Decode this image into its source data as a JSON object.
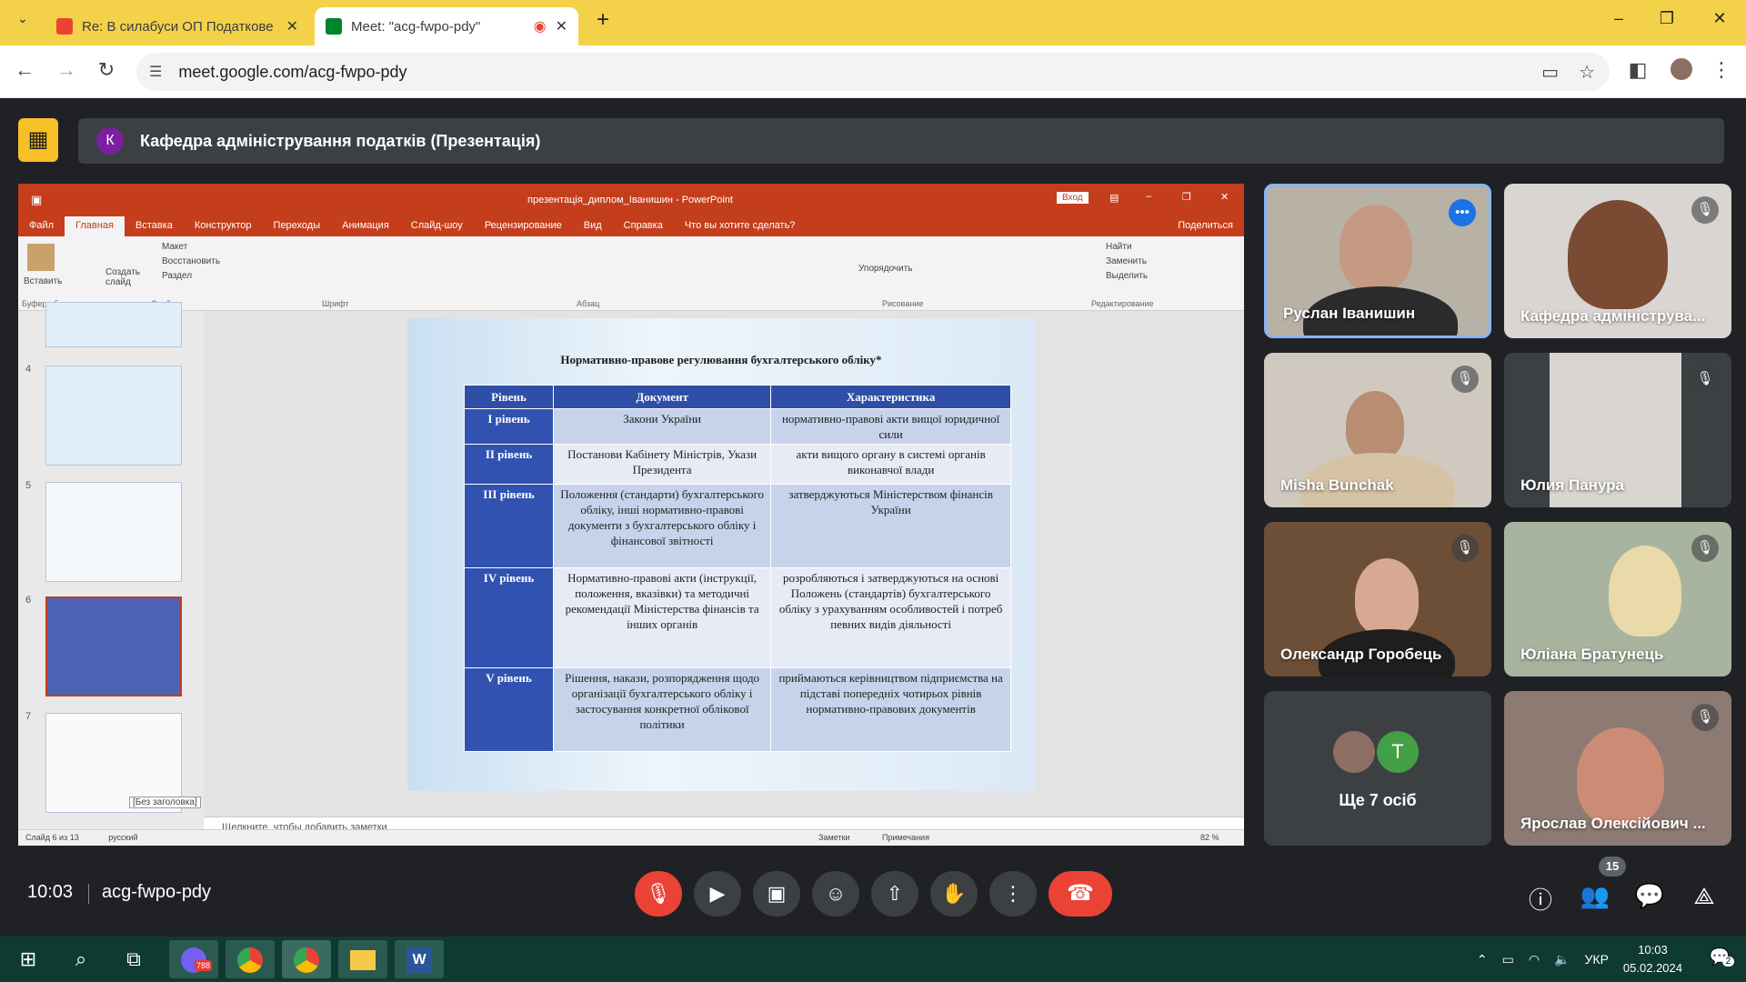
{
  "browser": {
    "tabs": [
      {
        "title": "Re: В силабуси ОП Податкове",
        "favicon_color": "#ea4335"
      },
      {
        "title": "Meet: \"acg-fwpo-pdy\"",
        "favicon_color": "#00832d"
      }
    ],
    "url": "meet.google.com/acg-fwpo-pdy"
  },
  "meet": {
    "presenter_initial": "К",
    "presentation_title": "Кафедра адміністрування податків (Презентація)",
    "time": "10:03",
    "meeting_code": "acg-fwpo-pdy",
    "participant_count": "15",
    "more_people": "Ще 7 осіб",
    "more_initial": "T"
  },
  "participants": [
    {
      "name": "Руслан Іванишин",
      "speaking": true
    },
    {
      "name": "Кафедра адмініструва...",
      "muted": true
    },
    {
      "name": "Misha Bunchak",
      "muted": true
    },
    {
      "name": "Юлия Панура",
      "muted": true
    },
    {
      "name": "Олександр Горобець",
      "muted": true
    },
    {
      "name": "Юліана Братунець",
      "muted": true
    },
    {
      "name": "Ярослав Олексійович ...",
      "muted": true
    }
  ],
  "powerpoint": {
    "window_title": "презентація_диплом_Іванишин - PowerPoint",
    "signin": "Вход",
    "menu": [
      "Файл",
      "Главная",
      "Вставка",
      "Конструктор",
      "Переходы",
      "Анимация",
      "Слайд-шоу",
      "Рецензирование",
      "Вид",
      "Справка",
      "Что вы хотите сделать?"
    ],
    "share": "Поделиться",
    "ribbon_groups": [
      "Буфер обмена",
      "Слайды",
      "Шрифт",
      "Абзац",
      "Рисование",
      "Редактирование"
    ],
    "ribbon_items": {
      "paste": "Вставить",
      "new_slide": "Создать слайд",
      "layout": "Макет",
      "reset": "Восстановить",
      "section": "Раздел",
      "arrange": "Упорядочить",
      "find": "Найти",
      "replace": "Заменить",
      "select": "Выделить"
    },
    "thumb_numbers": [
      "4",
      "5",
      "6",
      "7"
    ],
    "thumb_tooltip": "[Без заголовка]",
    "notes_placeholder": "Щелкните, чтобы добавить заметки",
    "status": {
      "slide": "Слайд 6 из 13",
      "lang": "русский",
      "notes": "Заметки",
      "comments": "Примечания",
      "zoom": "82 %"
    }
  },
  "slide": {
    "title": "Нормативно-правове регулювання бухгалтерського обліку*",
    "headers": [
      "Рівень",
      "Документ",
      "Характеристика"
    ],
    "rows": [
      {
        "level": "I рівень",
        "doc": "Закони України",
        "char": "нормативно-правові акти вищої юридичної сили"
      },
      {
        "level": "II рівень",
        "doc": "Постанови Кабінету Міністрів, Укази Президента",
        "char": "акти вищого органу в системі органів виконавчої влади"
      },
      {
        "level": "III рівень",
        "doc": "Положення (стандарти) бухгалтерського обліку, інші нормативно-правові документи з бухгалтерського обліку і фінансової звітності",
        "char": "затверджуються Міністерством фінансів України"
      },
      {
        "level": "IV рівень",
        "doc": "Нормативно-правові акти (інструкції, положення, вказівки) та методичні рекомендації Міністерства фінансів та інших органів",
        "char": "розробляються і затверджуються на основі Положень (стандартів) бухгалтерського обліку з урахуванням особливостей і потреб певних видів діяльності"
      },
      {
        "level": "V рівень",
        "doc": "Рішення, накази, розпорядження щодо організації бухгалтерського обліку і застосування конкретної облікової політики",
        "char": "приймаються керівництвом підприємства на підставі попередніх чотирьох рівнів нормативно-правових документів"
      }
    ]
  },
  "taskbar": {
    "lang": "УКР",
    "time": "10:03",
    "date": "05.02.2024",
    "notifications": "2",
    "viber_badge": "788"
  }
}
